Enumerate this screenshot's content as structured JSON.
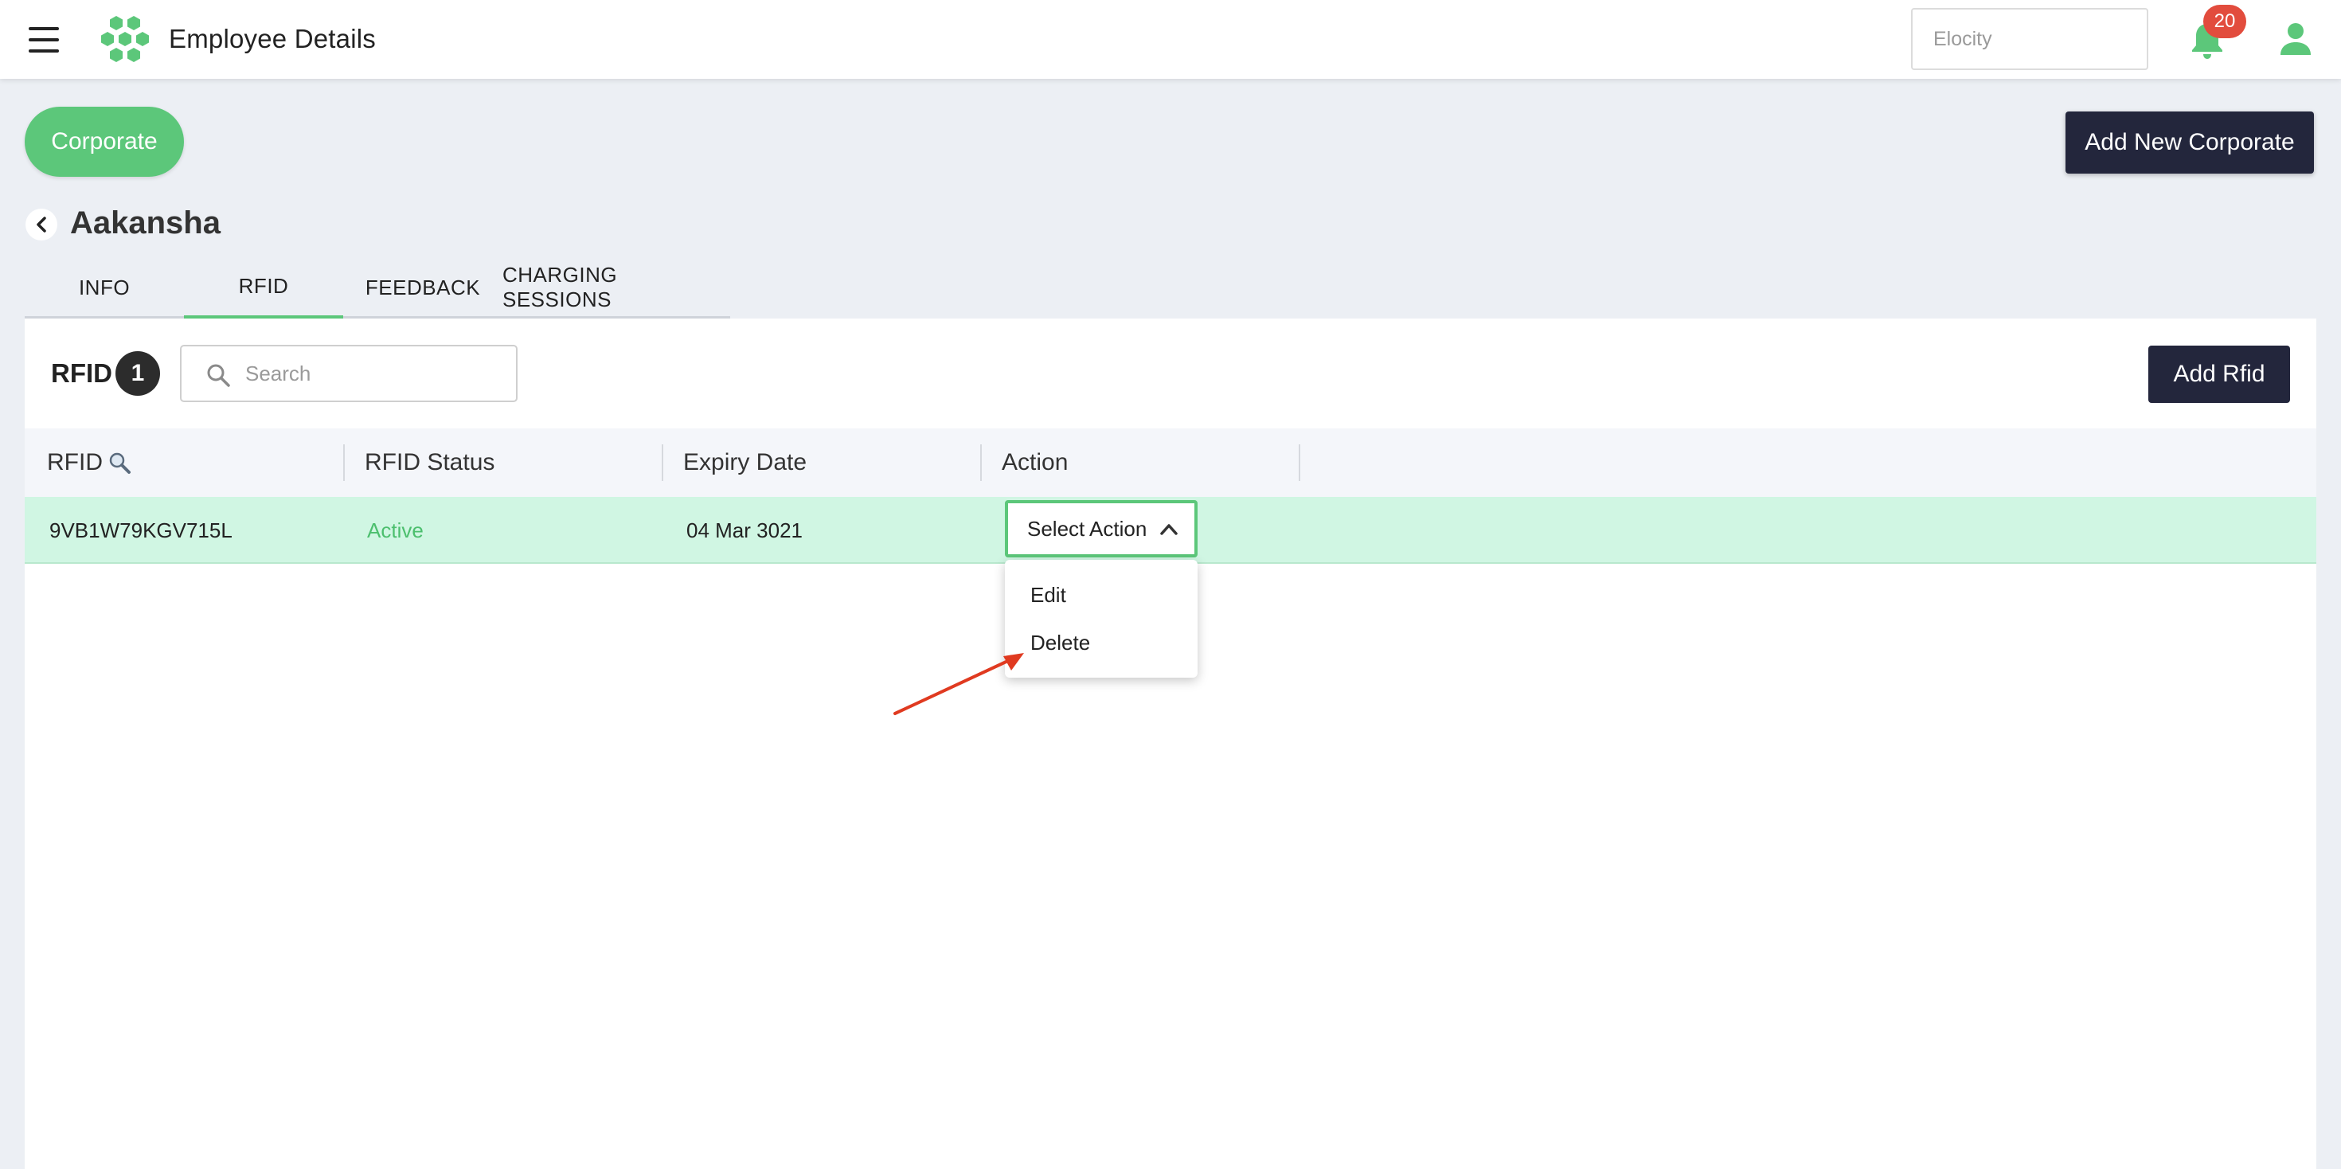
{
  "header": {
    "title": "Employee Details",
    "org_placeholder": "Elocity",
    "notification_count": "20",
    "icons": [
      "menu-icon",
      "logo-icon",
      "bell-icon",
      "user-icon"
    ],
    "brand_color": "#5cc77a",
    "badge_color": "#e24c3d"
  },
  "page": {
    "corporate_label": "Corporate",
    "add_corporate_label": "Add New Corporate",
    "employee_name": "Aakansha",
    "dark_button_color": "#23263c"
  },
  "tabs": [
    {
      "label": "INFO",
      "active": false
    },
    {
      "label": "RFID",
      "active": true
    },
    {
      "label": "FEEDBACK",
      "active": false
    },
    {
      "label": "CHARGING SESSIONS",
      "active": false
    }
  ],
  "rfid_section": {
    "title": "RFID",
    "count": "1",
    "search_placeholder": "Search",
    "add_button": "Add Rfid"
  },
  "table": {
    "columns": [
      "RFID",
      "RFID Status",
      "Expiry Date",
      "Action"
    ],
    "rows": [
      {
        "rfid": "9VB1W79KGV715L",
        "status": "Active",
        "expiry": "04 Mar 3021",
        "action": "Select Action"
      }
    ]
  },
  "action_menu": {
    "items": [
      "Edit",
      "Delete"
    ]
  }
}
